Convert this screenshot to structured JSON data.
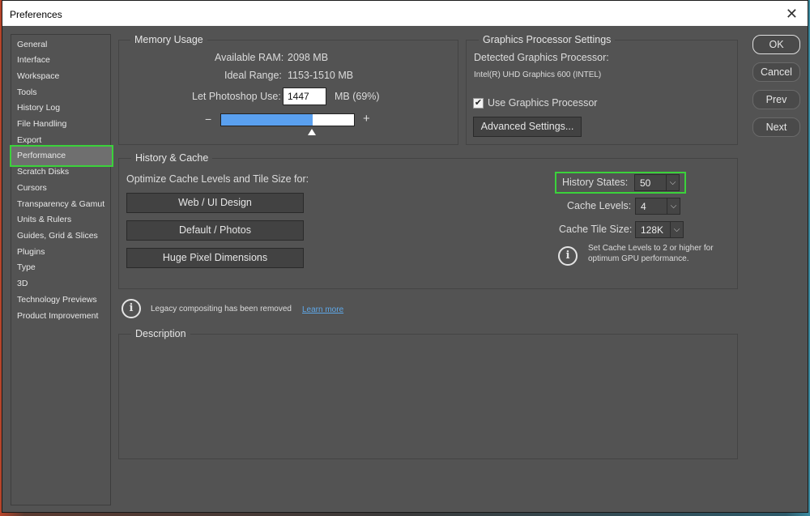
{
  "window": {
    "title": "Preferences",
    "close_glyph": "✕"
  },
  "sidebar": {
    "items": [
      {
        "label": "General"
      },
      {
        "label": "Interface"
      },
      {
        "label": "Workspace"
      },
      {
        "label": "Tools"
      },
      {
        "label": "History Log"
      },
      {
        "label": "File Handling"
      },
      {
        "label": "Export"
      },
      {
        "label": "Performance"
      },
      {
        "label": "Scratch Disks"
      },
      {
        "label": "Cursors"
      },
      {
        "label": "Transparency & Gamut"
      },
      {
        "label": "Units & Rulers"
      },
      {
        "label": "Guides, Grid & Slices"
      },
      {
        "label": "Plugins"
      },
      {
        "label": "Type"
      },
      {
        "label": "3D"
      },
      {
        "label": "Technology Previews"
      },
      {
        "label": "Product Improvement"
      }
    ],
    "active": "Performance"
  },
  "memory": {
    "title": "Memory Usage",
    "available_label": "Available RAM:",
    "available_value": "2098 MB",
    "ideal_label": "Ideal Range:",
    "ideal_value": "1153-1510 MB",
    "use_label": "Let Photoshop Use:",
    "use_value": "1447",
    "use_unit": "MB (69%)",
    "minus": "−",
    "plus": "+",
    "slider_fraction": 0.69
  },
  "gpu": {
    "title": "Graphics Processor Settings",
    "detected_label": "Detected Graphics Processor:",
    "detected_value": "Intel(R) UHD Graphics 600 (INTEL)",
    "use_gpu_label": "Use Graphics Processor",
    "use_gpu_checked": true,
    "advanced_button": "Advanced Settings..."
  },
  "history_cache": {
    "title": "History & Cache",
    "optimize_label": "Optimize Cache Levels and Tile Size for:",
    "buttons": [
      "Web / UI Design",
      "Default / Photos",
      "Huge Pixel Dimensions"
    ],
    "history_states_label": "History States:",
    "history_states_value": "50",
    "cache_levels_label": "Cache Levels:",
    "cache_levels_value": "4",
    "tile_size_label": "Cache Tile Size:",
    "tile_size_value": "128K",
    "info_note_line1": "Set Cache Levels to 2 or higher for",
    "info_note_line2": "optimum GPU performance."
  },
  "legacy": {
    "text": "Legacy compositing has been removed",
    "link": "Learn more"
  },
  "description": {
    "title": "Description"
  },
  "actions": {
    "ok": "OK",
    "cancel": "Cancel",
    "prev": "Prev",
    "next": "Next"
  },
  "colors": {
    "highlight": "#3bd23b",
    "slider_fill": "#5aa0ef",
    "link": "#5fa8e8"
  }
}
